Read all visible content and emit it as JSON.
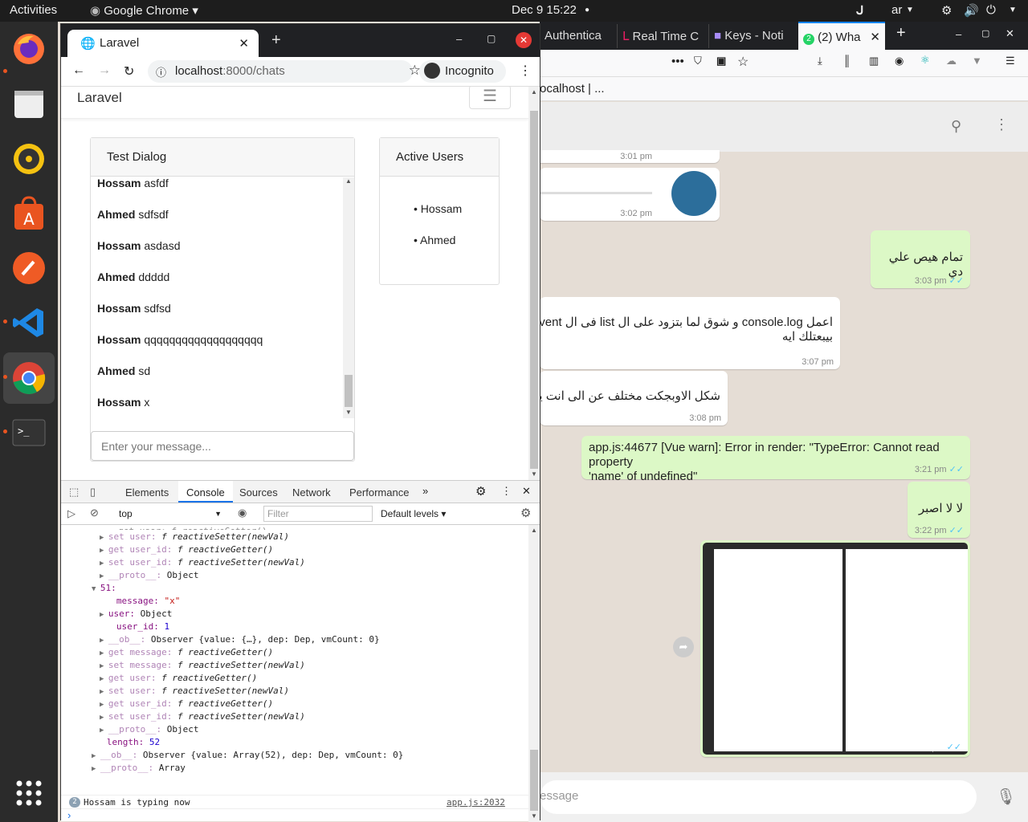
{
  "topbar": {
    "activities": "Activities",
    "app": "Google Chrome",
    "clock": "Dec 9  15:22",
    "lang": "ar"
  },
  "dock": [
    "firefox-icon",
    "files-icon",
    "rhythmbox-icon",
    "software-icon",
    "postman-icon",
    "vscode-icon",
    "chrome-icon",
    "terminal-icon",
    "apps-grid-icon"
  ],
  "firefox": {
    "tabs": [
      "Authentica",
      "Real Time C",
      "Keys - Noti",
      "(2) Wha"
    ],
    "tab_badge": "2",
    "bookmark": "ocalhost | ...",
    "footer_placeholder": "essage",
    "messages": [
      {
        "text": "",
        "time": "3:01 pm"
      },
      {
        "text": "",
        "time": "3:02 pm"
      },
      {
        "text": "تمام هيص علي دي",
        "time": "3:03 pm"
      },
      {
        "text": "اعمل console.log و شوق لما بتزود على ال list فى ال event",
        "text2": "بيبعتلك ايه",
        "time": "3:07 pm"
      },
      {
        "text": "شكل الاوبجكت مختلف عن الى انت يتح",
        "time": "3:08 pm"
      },
      {
        "text": "app.js:44677 [Vue warn]: Error in render: \"TypeError: Cannot read property",
        "text2": "'name' of undefined\"",
        "time": "3:21 pm"
      },
      {
        "text": "لا لا اصبر",
        "time": "3:22 pm"
      },
      {
        "text": "",
        "time": "3:22 pm"
      }
    ]
  },
  "chrome": {
    "tab_title": "Laravel",
    "url_host": "localhost",
    "url_path": ":8000/chats",
    "incognito": "Incognito",
    "brand": "Laravel",
    "dialog_title": "Test Dialog",
    "messages": [
      {
        "user": "Hossam",
        "text": "asfdf"
      },
      {
        "user": "Ahmed",
        "text": "sdfsdf"
      },
      {
        "user": "Hossam",
        "text": "asdasd"
      },
      {
        "user": "Ahmed",
        "text": "ddddd"
      },
      {
        "user": "Hossam",
        "text": "sdfsd"
      },
      {
        "user": "Hossam",
        "text": "qqqqqqqqqqqqqqqqqqq"
      },
      {
        "user": "Ahmed",
        "text": "sd"
      },
      {
        "user": "Hossam",
        "text": "x"
      }
    ],
    "input_placeholder": "Enter your message...",
    "active_title": "Active Users",
    "active_users": [
      "Hossam",
      "Ahmed"
    ]
  },
  "devtools": {
    "tabs": [
      "Elements",
      "Console",
      "Sources",
      "Network",
      "Performance"
    ],
    "context": "top",
    "filter_placeholder": "Filter",
    "levels": "Default levels",
    "lines": [
      {
        "d": 2,
        "k": "set user",
        "v": "f reactiveSetter(newVal)"
      },
      {
        "d": 2,
        "k": "get user_id",
        "v": "f reactiveGetter()"
      },
      {
        "d": 2,
        "k": "set user_id",
        "v": "f reactiveSetter(newVal)"
      },
      {
        "d": 2,
        "k": "__proto__",
        "v": "Object"
      },
      {
        "d": 1,
        "k": "51",
        "v": ""
      },
      {
        "d": 3,
        "k": "message",
        "v": "\"x\""
      },
      {
        "d": 2,
        "k": "user",
        "v": "Object"
      },
      {
        "d": 3,
        "k": "user_id",
        "v": "1"
      },
      {
        "d": 2,
        "k": "__ob__",
        "v": "Observer {value: {…}, dep: Dep, vmCount: 0}"
      },
      {
        "d": 2,
        "k": "get message",
        "v": "f reactiveGetter()"
      },
      {
        "d": 2,
        "k": "set message",
        "v": "f reactiveSetter(newVal)"
      },
      {
        "d": 2,
        "k": "get user",
        "v": "f reactiveGetter()"
      },
      {
        "d": 2,
        "k": "set user",
        "v": "f reactiveSetter(newVal)"
      },
      {
        "d": 2,
        "k": "get user_id",
        "v": "f reactiveGetter()"
      },
      {
        "d": 2,
        "k": "set user_id",
        "v": "f reactiveSetter(newVal)"
      },
      {
        "d": 2,
        "k": "__proto__",
        "v": "Object"
      },
      {
        "d": 1.5,
        "k": "length",
        "v": "52"
      },
      {
        "d": 1,
        "k": "__ob__",
        "v": "Observer {value: Array(52), dep: Dep, vmCount: 0}"
      },
      {
        "d": 1,
        "k": "__proto__",
        "v": "Array"
      }
    ],
    "log_count": "2",
    "log_text": "Hossam is typing now",
    "log_src": "app.js:2032"
  }
}
